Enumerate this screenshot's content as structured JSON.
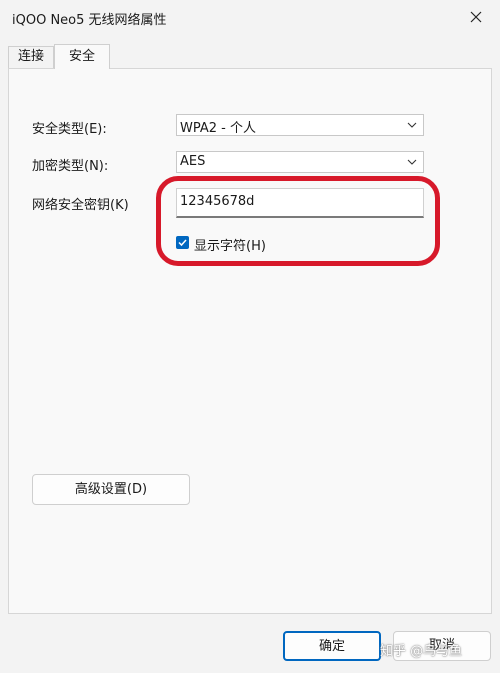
{
  "window": {
    "title": "iQOO Neo5 无线网络属性"
  },
  "tabs": [
    {
      "label": "连接"
    },
    {
      "label": "安全"
    }
  ],
  "security": {
    "type_label": "安全类型(E):",
    "type_value": "WPA2 - 个人",
    "encryption_label": "加密类型(N):",
    "encryption_value": "AES",
    "key_label": "网络安全密钥(K)",
    "key_value": "12345678d",
    "show_chars_label": "显示字符(H)",
    "show_chars_checked": true
  },
  "buttons": {
    "advanced": "高级设置(D)",
    "ok": "确定",
    "cancel": "取消"
  },
  "watermark": "知乎 @鸟与鱼",
  "colors": {
    "accent": "#0067c0",
    "highlight": "#d7192a"
  },
  "icons": {
    "close": "close-icon",
    "chevron": "chevron-down-icon",
    "check": "check-icon"
  }
}
